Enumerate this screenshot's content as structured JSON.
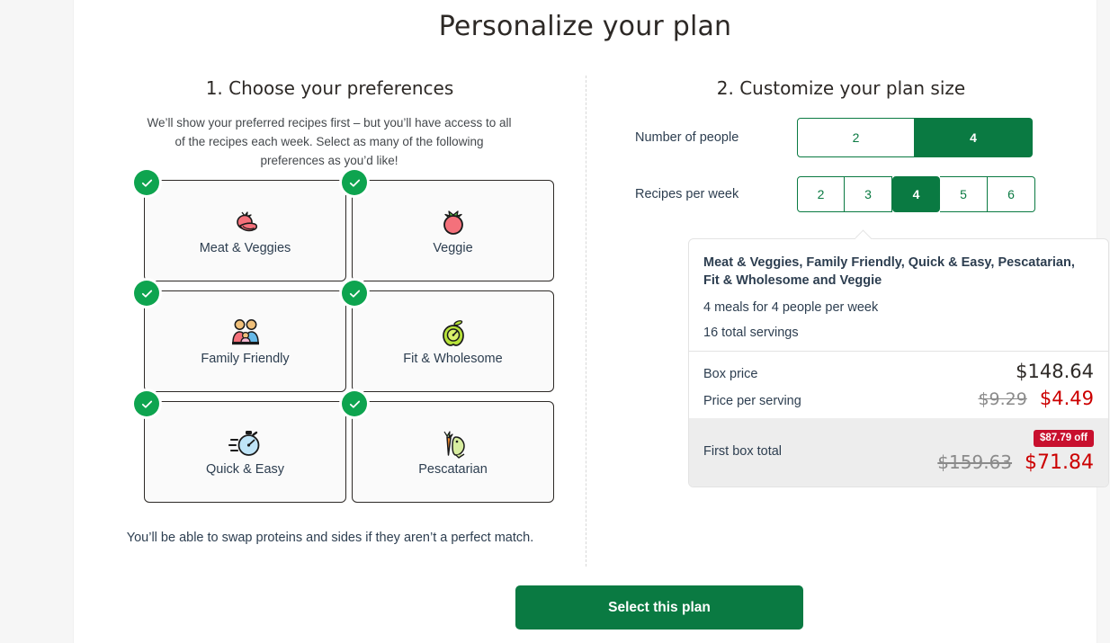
{
  "page": {
    "title": "Personalize your plan",
    "background_color": "#f6f6f6",
    "card_color": "#ffffff"
  },
  "colors": {
    "brand_green": "#0a7a42",
    "check_green": "#0ea44f",
    "sale_red": "#cc0000",
    "badge_red": "#c8102e",
    "text_dark": "#2d3e50"
  },
  "preferences": {
    "heading": "1. Choose your preferences",
    "description": "We’ll show your preferred recipes first – but you’ll have access to all of the recipes each week. Select as many of the following preferences as you’d like!",
    "items": [
      {
        "label": "Meat & Veggies",
        "icon": "meat-veggies-icon",
        "selected": true
      },
      {
        "label": "Veggie",
        "icon": "tomato-icon",
        "selected": true
      },
      {
        "label": "Family Friendly",
        "icon": "family-icon",
        "selected": true
      },
      {
        "label": "Fit & Wholesome",
        "icon": "apple-gauge-icon",
        "selected": true
      },
      {
        "label": "Quick & Easy",
        "icon": "stopwatch-icon",
        "selected": true
      },
      {
        "label": "Pescatarian",
        "icon": "carrot-fish-icon",
        "selected": true
      }
    ],
    "footnote": "You’ll be able to swap proteins and sides if they aren’t a perfect match."
  },
  "plan_size": {
    "heading": "2. Customize your plan size",
    "people": {
      "label": "Number of people",
      "options": [
        "2",
        "4"
      ],
      "selected": "4"
    },
    "recipes": {
      "label": "Recipes per week",
      "options": [
        "2",
        "3",
        "4",
        "5",
        "6"
      ],
      "selected": "4"
    }
  },
  "summary": {
    "preferences_line": "Meat & Veggies, Family Friendly, Quick & Easy, Pescatarian, Fit & Wholesome and Veggie",
    "meals_line": "4 meals for 4 people per week",
    "servings_line": "16 total servings",
    "box_price": {
      "label": "Box price",
      "value": "$148.64"
    },
    "price_per_serving": {
      "label": "Price per serving",
      "old": "$9.29",
      "new": "$4.49"
    },
    "first_box_total": {
      "label": "First box total",
      "badge": "$87.79 off",
      "old": "$159.63",
      "new": "$71.84"
    }
  },
  "cta": {
    "label": "Select this plan"
  }
}
